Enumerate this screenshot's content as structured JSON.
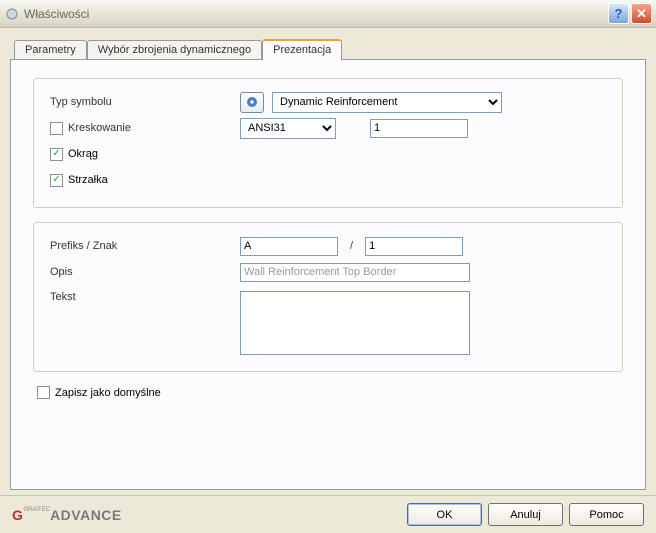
{
  "window": {
    "title": "Właściwości"
  },
  "tabs": {
    "parameters": "Parametry",
    "dynamic_selection": "Wybór zbrojenia dynamicznego",
    "presentation": "Prezentacja"
  },
  "group1": {
    "symbol_type_label": "Typ symbolu",
    "symbol_type_value": "Dynamic Reinforcement",
    "hatch_label": "Kreskowanie",
    "hatch_value": "ANSI31",
    "hatch_scale": "1",
    "circle_label": "Okrąg",
    "arrow_label": "Strzałka"
  },
  "group2": {
    "prefix_label": "Prefiks / Znak",
    "prefix_value": "A",
    "prefix_num": "1",
    "desc_label": "Opis",
    "desc_value": "Wall Reinforcement Top Border",
    "text_label": "Tekst",
    "text_value": ""
  },
  "save_default_label": "Zapisz jako domyślne",
  "logo": {
    "prefix": "G",
    "brand_small": "GRAITEC",
    "brand": "ADVANCE"
  },
  "buttons": {
    "ok": "OK",
    "cancel": "Anuluj",
    "help": "Pomoc"
  },
  "checks": {
    "hatch": false,
    "circle": true,
    "arrow": true,
    "save_default": false
  }
}
